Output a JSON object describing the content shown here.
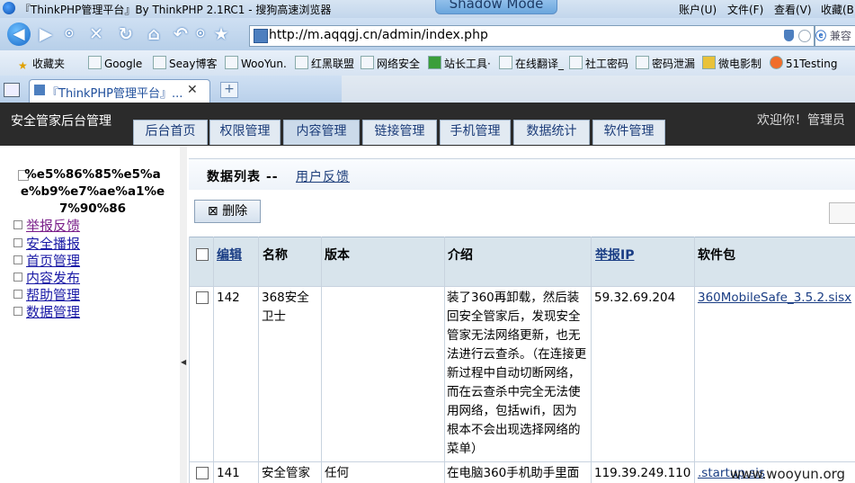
{
  "window": {
    "title": "『ThinkPHP管理平台』By ThinkPHP 2.1RC1 - 搜狗高速浏览器",
    "mode_badge": "Shadow Mode",
    "menu": [
      "账户(U)",
      "文件(F)",
      "查看(V)",
      "收藏(B)"
    ]
  },
  "toolbar": {
    "url": "http://m.aqqgj.cn/admin/index.php",
    "search_placeholder": "兼容"
  },
  "bookmarks": [
    "收藏夹",
    "Google",
    "Seay博客",
    "WooYun.",
    "红黑联盟",
    "网络安全",
    "站长工具·",
    "在线翻译_",
    "社工密码",
    "密码泄漏",
    "微电影制",
    "51Testing"
  ],
  "tab": {
    "label": "『ThinkPHP管理平台』...",
    "close": "✕"
  },
  "app": {
    "title": "安全管家后台管理",
    "nav_tabs": [
      "后台首页",
      "权限管理",
      "内容管理",
      "链接管理",
      "手机管理",
      "数据统计",
      "软件管理"
    ],
    "active_tab": "内容管理",
    "welcome": "欢迎你！管理员"
  },
  "sidebar": {
    "heading": "%e5%86%85%e5%ae%b9%e7%ae%a1%e7%90%86",
    "items": [
      "举报反馈",
      "安全播报",
      "首页管理",
      "内容发布",
      "帮助管理",
      "数据管理"
    ]
  },
  "content": {
    "title": "数据列表",
    "separator": "--",
    "subtitle": "用户反馈",
    "delete_button": "删除",
    "columns": [
      "编辑",
      "名称",
      "版本",
      "介绍",
      "举报IP",
      "软件包"
    ],
    "rows": [
      {
        "id": "142",
        "name": "368安全卫士",
        "version": "",
        "intro": "装了360再卸载，然后装回安全管家后，发现安全管家无法网络更新，也无法进行云查杀。（在连接更新过程中自动切断网络，而在云查杀中完全无法使用网络，包括wifi，因为根本不会出现选择网络的菜单）",
        "ip": "59.32.69.204",
        "package": "360MobileSafe_3.5.2.sisx"
      },
      {
        "id": "141",
        "name": "安全管家",
        "version": "任何",
        "intro": "在电脑360手机助手里面",
        "ip": "119.39.249.110",
        "package": ".startup.sis"
      }
    ]
  },
  "watermark": "www.wooyun.org"
}
